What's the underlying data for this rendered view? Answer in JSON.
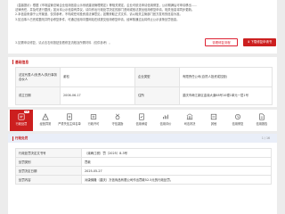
{
  "notice": {
    "lines": [
      "（温馨提示）根据《市场监管总局企业信用信息公示系统建设管理规定》等相关规定，企业可依法申请信用修复，公示期满后可申请移出……",
      "法律责任，并及时进行整改；如对本公示信息有异议，请向作出行政处罚决定的部门咨询或依法提出信用修复申请，相关信息将同步更新。",
      "2.本信息来源于公开渠道，仅供参考，不构成任何投资或法律意见；如需获取正式文件，请以相关主管部门官方发布的信息为准。",
      "3.如当事人已完成整改并符合修复条件，可通过信用中国网站在线提交信用修复申请，经审核通过后将停止公示该条处罚信息。"
    ],
    "footer_text": "3.如需申请修复，请点击右侧按钮查看修复流程及所需材料（仅供参考）。",
    "btn_outline_label": "查看修复流程",
    "btn_solid_label": "下载修复申请书"
  },
  "basic": {
    "title": "基础信息",
    "rows": [
      [
        {
          "k": "法定代表人/负责人/执行事务合伙人",
          "v": "谢松"
        },
        {
          "k": "企业类型",
          "v": "有限责任公司(自然人投资或控股)"
        }
      ],
      [
        {
          "k": "成立日期",
          "v": "2006-06-17"
        },
        {
          "k": "住所",
          "v": "重庆市两江新区金渝大道68号10幢1单元一层1号"
        }
      ]
    ]
  },
  "tabs": [
    {
      "label": "行政处罚",
      "badge": "16",
      "icon": "gavel-icon",
      "active": true
    },
    {
      "label": "经营异常",
      "badge": "",
      "icon": "warning-icon",
      "active": false
    },
    {
      "label": "严重失信主体名单",
      "badge": "",
      "icon": "blacklist-icon",
      "active": false
    },
    {
      "label": "行政许可",
      "badge": "",
      "icon": "license-icon",
      "active": false
    },
    {
      "label": "守信激励",
      "badge": "",
      "icon": "medal-icon",
      "active": false
    },
    {
      "label": "信用承诺",
      "badge": "",
      "icon": "promise-icon",
      "active": false
    },
    {
      "label": "信用评价",
      "badge": "",
      "icon": "rating-icon",
      "active": false
    },
    {
      "label": "司法判决",
      "badge": "",
      "icon": "court-icon",
      "active": false
    },
    {
      "label": "其他",
      "badge": "",
      "icon": "more-icon",
      "active": false
    },
    {
      "label": "信用修复",
      "badge": "",
      "icon": "repair-icon",
      "active": false
    },
    {
      "label": "信用报告",
      "badge": "",
      "icon": "report-icon",
      "active": false
    }
  ],
  "penalty": {
    "title": "行政处罚",
    "meta": "1 / 16",
    "rows": [
      {
        "k": "行政处罚决定文书号",
        "v": "（渝两江税）罚〔2025〕8-3号"
      },
      {
        "k": "处罚类别",
        "v": "罚款"
      },
      {
        "k": "处罚决定日期",
        "v": "2025-05-27"
      },
      {
        "k": "处罚内容",
        "v": "对康佛隆（重庆）万信商品有限公司作出罚款52.5元的行政处罚。"
      }
    ]
  },
  "colors": {
    "accent": "#cc1f1f",
    "link": "#3b63c4",
    "header_band": "#e9eef8"
  }
}
